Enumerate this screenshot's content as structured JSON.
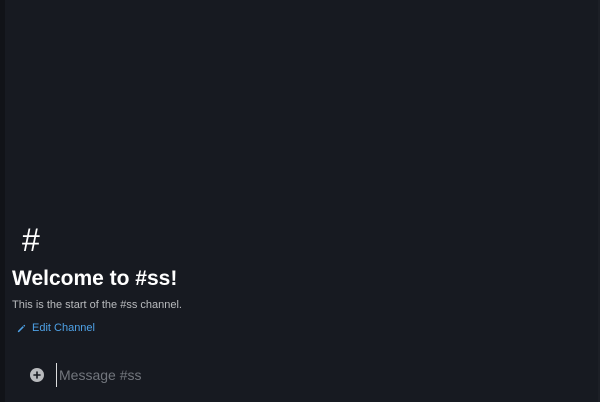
{
  "channel": {
    "hash_symbol": "#",
    "welcome_title": "Welcome to #ss!",
    "intro_text": "This is the start of the #ss channel.",
    "edit_label": "Edit Channel"
  },
  "composer": {
    "placeholder": "Message #ss",
    "value": "",
    "add_icon": "plus-circle-icon"
  },
  "icons": {
    "edit": "pencil-icon",
    "add": "plus-circle-icon"
  },
  "colors": {
    "background": "#171a21",
    "link": "#4ea1e6",
    "title": "#ffffff",
    "muted_text": "#b9bbbe",
    "placeholder": "#72767d"
  }
}
